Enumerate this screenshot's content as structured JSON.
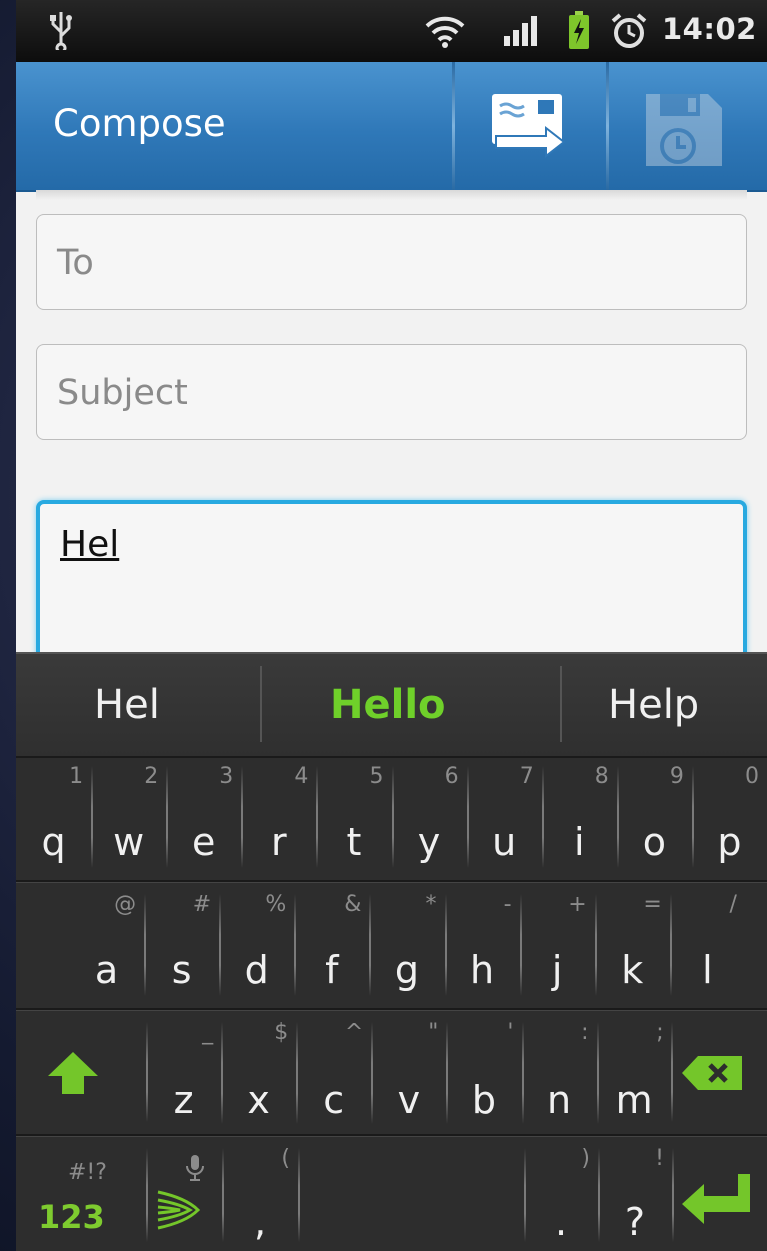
{
  "status_bar": {
    "time": "14:02",
    "icons": [
      "usb-icon",
      "wifi-icon",
      "signal-icon",
      "battery-charging-icon",
      "alarm-icon"
    ]
  },
  "action_bar": {
    "title": "Compose",
    "actions": [
      "send-icon",
      "save-draft-icon"
    ]
  },
  "form": {
    "to_placeholder": "To",
    "subject_placeholder": "Subject",
    "body_value": "Hel"
  },
  "keyboard": {
    "suggestions": [
      "Hel",
      "Hello",
      "Help"
    ],
    "row1": [
      {
        "main": "q",
        "alt": "1"
      },
      {
        "main": "w",
        "alt": "2"
      },
      {
        "main": "e",
        "alt": "3"
      },
      {
        "main": "r",
        "alt": "4"
      },
      {
        "main": "t",
        "alt": "5"
      },
      {
        "main": "y",
        "alt": "6"
      },
      {
        "main": "u",
        "alt": "7"
      },
      {
        "main": "i",
        "alt": "8"
      },
      {
        "main": "o",
        "alt": "9"
      },
      {
        "main": "p",
        "alt": "0"
      }
    ],
    "row2": [
      {
        "main": "a",
        "alt": "@"
      },
      {
        "main": "s",
        "alt": "#"
      },
      {
        "main": "d",
        "alt": "%"
      },
      {
        "main": "f",
        "alt": "&"
      },
      {
        "main": "g",
        "alt": "*"
      },
      {
        "main": "h",
        "alt": "-"
      },
      {
        "main": "j",
        "alt": "+"
      },
      {
        "main": "k",
        "alt": "="
      },
      {
        "main": "l",
        "alt": "/"
      }
    ],
    "row3": [
      {
        "main": "z",
        "alt": "_"
      },
      {
        "main": "x",
        "alt": "$"
      },
      {
        "main": "c",
        "alt": "^"
      },
      {
        "main": "v",
        "alt": "\""
      },
      {
        "main": "b",
        "alt": "'"
      },
      {
        "main": "n",
        "alt": ":"
      },
      {
        "main": "m",
        "alt": ";"
      }
    ],
    "row4": {
      "numbers_label": "123",
      "numbers_alt": "#!?",
      "comma": ",",
      "comma_alt": "(",
      "period": ".",
      "period_alt": ")",
      "question": "?",
      "question_alt": "!"
    }
  },
  "colors": {
    "action_bar": "#2f78b8",
    "focus": "#28a9e0",
    "suggestion_highlight": "#6fd02a"
  }
}
